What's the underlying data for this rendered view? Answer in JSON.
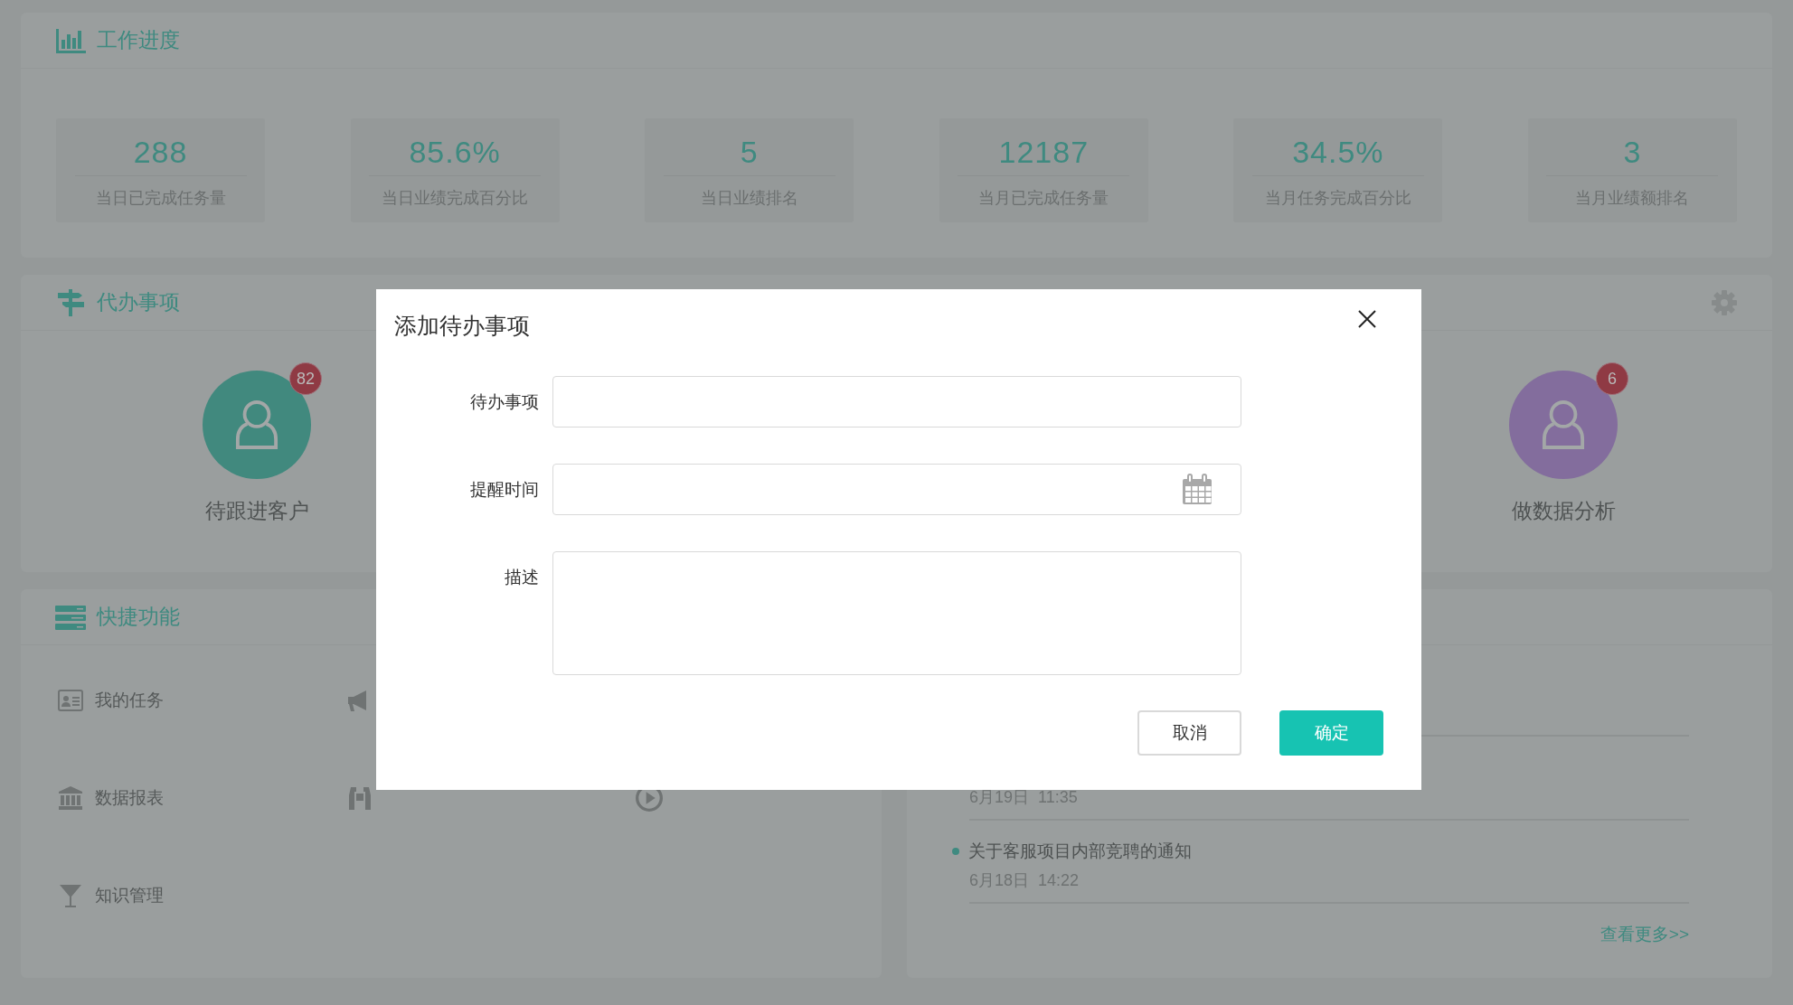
{
  "work_progress": {
    "title": "工作进度",
    "stats": [
      {
        "value": "288",
        "label": "当日已完成任务量"
      },
      {
        "value": "85.6%",
        "label": "当日业绩完成百分比"
      },
      {
        "value": "5",
        "label": "当日业绩排名"
      },
      {
        "value": "12187",
        "label": "当月已完成任务量"
      },
      {
        "value": "34.5%",
        "label": "当月任务完成百分比"
      },
      {
        "value": "3",
        "label": "当月业绩额排名"
      }
    ]
  },
  "todo": {
    "title": "代办事项",
    "items": [
      {
        "label": "待跟进客户",
        "badge": "82",
        "color": "#41897e"
      },
      {
        "label": "做数据分析",
        "badge": "6",
        "color": "#836d9d"
      }
    ]
  },
  "shortcuts": {
    "title": "快捷功能",
    "rows": [
      {
        "items": [
          {
            "kind": "card",
            "label": "我的任务"
          },
          {
            "kind": "megaphone"
          }
        ]
      },
      {
        "items": [
          {
            "kind": "bank",
            "label": "数据报表"
          },
          {
            "kind": "binoculars"
          },
          {
            "kind": "play"
          }
        ]
      },
      {
        "items": [
          {
            "kind": "funnel",
            "label": "知识管理"
          }
        ]
      }
    ]
  },
  "notices": {
    "items": [
      {
        "date": "6月19日  11:35"
      },
      {
        "title": "关于客服项目内部竞聘的通知",
        "date": "6月18日  14:22"
      }
    ],
    "more": "查看更多>>"
  },
  "dialog": {
    "title": "添加待办事项",
    "fields": [
      {
        "label": "待办事项",
        "kind": "text"
      },
      {
        "label": "提醒时间",
        "kind": "date"
      },
      {
        "label": "描述",
        "kind": "textarea"
      }
    ],
    "buttons": [
      {
        "label": "取消",
        "kind": "secondary"
      },
      {
        "label": "确定",
        "kind": "primary"
      }
    ]
  }
}
